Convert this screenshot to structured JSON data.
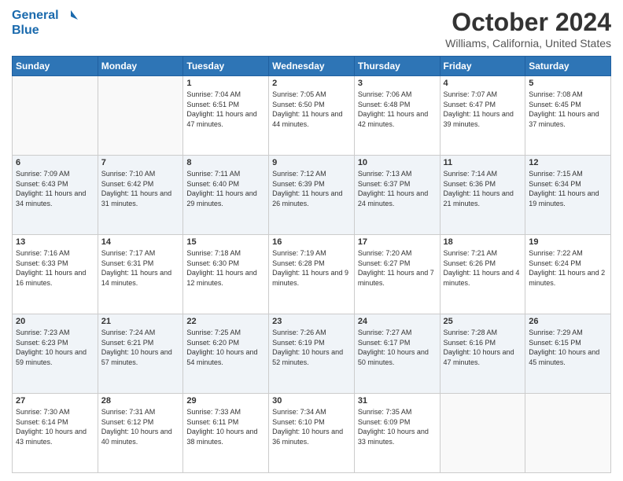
{
  "header": {
    "logo_line1": "General",
    "logo_line2": "Blue",
    "title": "October 2024",
    "subtitle": "Williams, California, United States"
  },
  "days_of_week": [
    "Sunday",
    "Monday",
    "Tuesday",
    "Wednesday",
    "Thursday",
    "Friday",
    "Saturday"
  ],
  "weeks": [
    [
      {
        "day": "",
        "sunrise": "",
        "sunset": "",
        "daylight": ""
      },
      {
        "day": "",
        "sunrise": "",
        "sunset": "",
        "daylight": ""
      },
      {
        "day": "1",
        "sunrise": "Sunrise: 7:04 AM",
        "sunset": "Sunset: 6:51 PM",
        "daylight": "Daylight: 11 hours and 47 minutes."
      },
      {
        "day": "2",
        "sunrise": "Sunrise: 7:05 AM",
        "sunset": "Sunset: 6:50 PM",
        "daylight": "Daylight: 11 hours and 44 minutes."
      },
      {
        "day": "3",
        "sunrise": "Sunrise: 7:06 AM",
        "sunset": "Sunset: 6:48 PM",
        "daylight": "Daylight: 11 hours and 42 minutes."
      },
      {
        "day": "4",
        "sunrise": "Sunrise: 7:07 AM",
        "sunset": "Sunset: 6:47 PM",
        "daylight": "Daylight: 11 hours and 39 minutes."
      },
      {
        "day": "5",
        "sunrise": "Sunrise: 7:08 AM",
        "sunset": "Sunset: 6:45 PM",
        "daylight": "Daylight: 11 hours and 37 minutes."
      }
    ],
    [
      {
        "day": "6",
        "sunrise": "Sunrise: 7:09 AM",
        "sunset": "Sunset: 6:43 PM",
        "daylight": "Daylight: 11 hours and 34 minutes."
      },
      {
        "day": "7",
        "sunrise": "Sunrise: 7:10 AM",
        "sunset": "Sunset: 6:42 PM",
        "daylight": "Daylight: 11 hours and 31 minutes."
      },
      {
        "day": "8",
        "sunrise": "Sunrise: 7:11 AM",
        "sunset": "Sunset: 6:40 PM",
        "daylight": "Daylight: 11 hours and 29 minutes."
      },
      {
        "day": "9",
        "sunrise": "Sunrise: 7:12 AM",
        "sunset": "Sunset: 6:39 PM",
        "daylight": "Daylight: 11 hours and 26 minutes."
      },
      {
        "day": "10",
        "sunrise": "Sunrise: 7:13 AM",
        "sunset": "Sunset: 6:37 PM",
        "daylight": "Daylight: 11 hours and 24 minutes."
      },
      {
        "day": "11",
        "sunrise": "Sunrise: 7:14 AM",
        "sunset": "Sunset: 6:36 PM",
        "daylight": "Daylight: 11 hours and 21 minutes."
      },
      {
        "day": "12",
        "sunrise": "Sunrise: 7:15 AM",
        "sunset": "Sunset: 6:34 PM",
        "daylight": "Daylight: 11 hours and 19 minutes."
      }
    ],
    [
      {
        "day": "13",
        "sunrise": "Sunrise: 7:16 AM",
        "sunset": "Sunset: 6:33 PM",
        "daylight": "Daylight: 11 hours and 16 minutes."
      },
      {
        "day": "14",
        "sunrise": "Sunrise: 7:17 AM",
        "sunset": "Sunset: 6:31 PM",
        "daylight": "Daylight: 11 hours and 14 minutes."
      },
      {
        "day": "15",
        "sunrise": "Sunrise: 7:18 AM",
        "sunset": "Sunset: 6:30 PM",
        "daylight": "Daylight: 11 hours and 12 minutes."
      },
      {
        "day": "16",
        "sunrise": "Sunrise: 7:19 AM",
        "sunset": "Sunset: 6:28 PM",
        "daylight": "Daylight: 11 hours and 9 minutes."
      },
      {
        "day": "17",
        "sunrise": "Sunrise: 7:20 AM",
        "sunset": "Sunset: 6:27 PM",
        "daylight": "Daylight: 11 hours and 7 minutes."
      },
      {
        "day": "18",
        "sunrise": "Sunrise: 7:21 AM",
        "sunset": "Sunset: 6:26 PM",
        "daylight": "Daylight: 11 hours and 4 minutes."
      },
      {
        "day": "19",
        "sunrise": "Sunrise: 7:22 AM",
        "sunset": "Sunset: 6:24 PM",
        "daylight": "Daylight: 11 hours and 2 minutes."
      }
    ],
    [
      {
        "day": "20",
        "sunrise": "Sunrise: 7:23 AM",
        "sunset": "Sunset: 6:23 PM",
        "daylight": "Daylight: 10 hours and 59 minutes."
      },
      {
        "day": "21",
        "sunrise": "Sunrise: 7:24 AM",
        "sunset": "Sunset: 6:21 PM",
        "daylight": "Daylight: 10 hours and 57 minutes."
      },
      {
        "day": "22",
        "sunrise": "Sunrise: 7:25 AM",
        "sunset": "Sunset: 6:20 PM",
        "daylight": "Daylight: 10 hours and 54 minutes."
      },
      {
        "day": "23",
        "sunrise": "Sunrise: 7:26 AM",
        "sunset": "Sunset: 6:19 PM",
        "daylight": "Daylight: 10 hours and 52 minutes."
      },
      {
        "day": "24",
        "sunrise": "Sunrise: 7:27 AM",
        "sunset": "Sunset: 6:17 PM",
        "daylight": "Daylight: 10 hours and 50 minutes."
      },
      {
        "day": "25",
        "sunrise": "Sunrise: 7:28 AM",
        "sunset": "Sunset: 6:16 PM",
        "daylight": "Daylight: 10 hours and 47 minutes."
      },
      {
        "day": "26",
        "sunrise": "Sunrise: 7:29 AM",
        "sunset": "Sunset: 6:15 PM",
        "daylight": "Daylight: 10 hours and 45 minutes."
      }
    ],
    [
      {
        "day": "27",
        "sunrise": "Sunrise: 7:30 AM",
        "sunset": "Sunset: 6:14 PM",
        "daylight": "Daylight: 10 hours and 43 minutes."
      },
      {
        "day": "28",
        "sunrise": "Sunrise: 7:31 AM",
        "sunset": "Sunset: 6:12 PM",
        "daylight": "Daylight: 10 hours and 40 minutes."
      },
      {
        "day": "29",
        "sunrise": "Sunrise: 7:33 AM",
        "sunset": "Sunset: 6:11 PM",
        "daylight": "Daylight: 10 hours and 38 minutes."
      },
      {
        "day": "30",
        "sunrise": "Sunrise: 7:34 AM",
        "sunset": "Sunset: 6:10 PM",
        "daylight": "Daylight: 10 hours and 36 minutes."
      },
      {
        "day": "31",
        "sunrise": "Sunrise: 7:35 AM",
        "sunset": "Sunset: 6:09 PM",
        "daylight": "Daylight: 10 hours and 33 minutes."
      },
      {
        "day": "",
        "sunrise": "",
        "sunset": "",
        "daylight": ""
      },
      {
        "day": "",
        "sunrise": "",
        "sunset": "",
        "daylight": ""
      }
    ]
  ]
}
